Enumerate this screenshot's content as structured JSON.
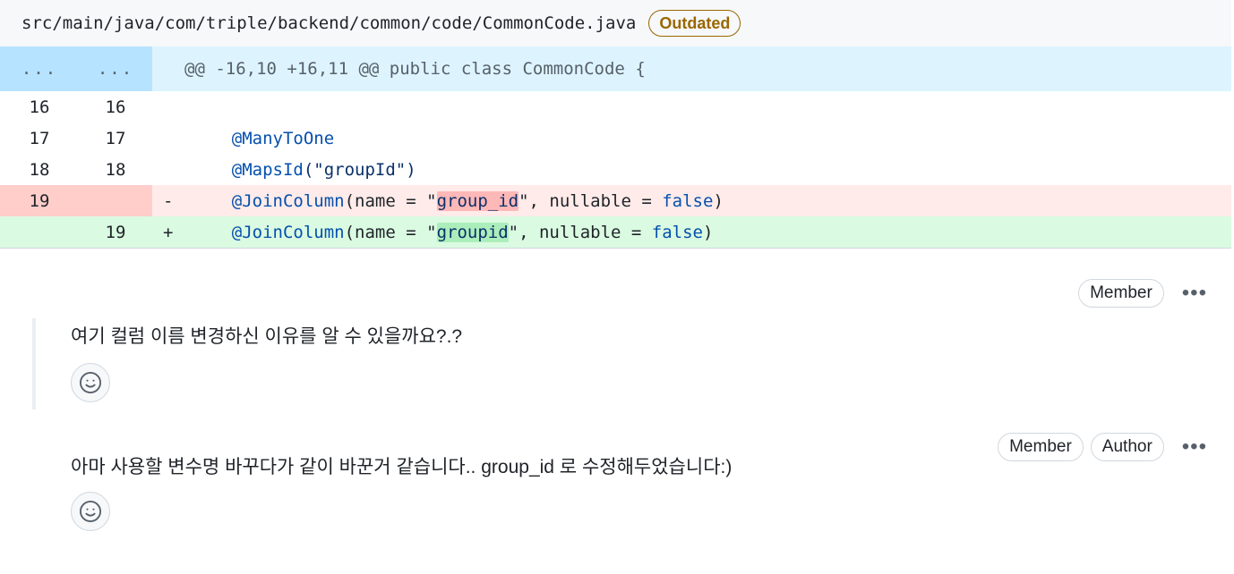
{
  "file": {
    "path": "src/main/java/com/triple/backend/common/code/CommonCode.java",
    "status_badge": "Outdated"
  },
  "diff": {
    "hunk": {
      "old": "...",
      "new": "...",
      "header": "@@ -16,10 +16,11 @@ public class CommonCode {"
    },
    "rows": [
      {
        "type": "ctx",
        "old": "16",
        "new": "16",
        "sign": "",
        "code": ""
      },
      {
        "type": "ctx",
        "old": "17",
        "new": "17",
        "sign": "",
        "annotation": "@ManyToOne"
      },
      {
        "type": "ctx",
        "old": "18",
        "new": "18",
        "sign": "",
        "annotation": "@MapsId",
        "rest": "(\"groupId\")"
      },
      {
        "type": "del",
        "old": "19",
        "new": "",
        "sign": "-",
        "annotation": "@JoinColumn",
        "pre": "(name = \"",
        "highlight": "group_id",
        "post": "\", nullable = ",
        "keyword": "false",
        "end": ")"
      },
      {
        "type": "add",
        "old": "",
        "new": "19",
        "sign": "+",
        "annotation": "@JoinColumn",
        "pre": "(name = \"",
        "highlight": "groupid",
        "post": "\", nullable = ",
        "keyword": "false",
        "end": ")"
      }
    ]
  },
  "comments": [
    {
      "tags": [
        "Member"
      ],
      "more": "•••",
      "body": "여기 컬럼 이름 변경하신 이유를 알 수 있을까요?.?",
      "reaction_icon": "smiley-icon"
    },
    {
      "tags": [
        "Member",
        "Author"
      ],
      "more": "•••",
      "body": "아마 사용할 변수명 바꾸다가 같이 바꾼거 같습니다.. group_id 로 수정해두었습니다:)",
      "reaction_icon": "smiley-icon"
    }
  ],
  "colors": {
    "outdated": "#9a6700",
    "deletion_bg": "#ffebe9",
    "addition_bg": "#dafbe1",
    "hunk_bg": "#ddf4ff"
  }
}
